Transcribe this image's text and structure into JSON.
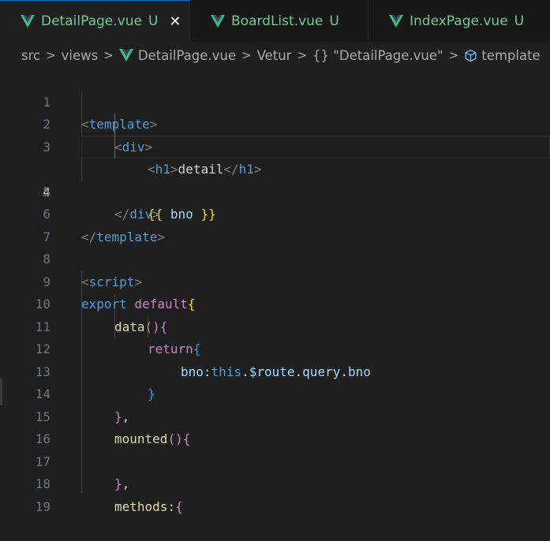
{
  "tabs": [
    {
      "label": "DetailPage.vue",
      "badge": "U",
      "close": "✕"
    },
    {
      "label": "BoardList.vue",
      "badge": "U"
    },
    {
      "label": "IndexPage.vue",
      "badge": "U"
    }
  ],
  "breadcrumb": {
    "items": [
      "src",
      "views",
      "DetailPage.vue",
      "Vetur",
      "{} \"DetailPage.vue\"",
      "template"
    ],
    "separator": ">"
  },
  "editor": {
    "current_line": "4",
    "line_numbers": [
      "1",
      "2",
      "3",
      "4",
      "5",
      "6",
      "7",
      "8",
      "9",
      "10",
      "11",
      "12",
      "13",
      "14",
      "15",
      "16",
      "17",
      "18",
      "19"
    ],
    "code": {
      "l1": {
        "a": "<",
        "b": "template",
        "c": ">"
      },
      "l2": {
        "a": "<",
        "b": "div",
        "c": ">"
      },
      "l3": {
        "a": "<",
        "b": "h1",
        "c": ">",
        "d": "detail",
        "e": "</",
        "f": "h1",
        "g": ">"
      },
      "l4": {
        "a": "{{",
        "b": " bno ",
        "c": "}}"
      },
      "l5": {
        "a": "</",
        "b": "div",
        "c": ">"
      },
      "l6": {
        "a": "</",
        "b": "template",
        "c": ">"
      },
      "l8": {
        "a": "<",
        "b": "script",
        "c": ">"
      },
      "l9": {
        "a": "export",
        "b": " default",
        "c": "{"
      },
      "l10": {
        "a": "data",
        "b": "()",
        "c": "{"
      },
      "l11": {
        "a": "return",
        "b": "{"
      },
      "l12": {
        "a": "bno",
        "b": ":",
        "c": "this",
        "d": ".",
        "e": "$route",
        "f": ".",
        "g": "query",
        "h": ".",
        "i": "bno"
      },
      "l13": {
        "a": "}"
      },
      "l14": {
        "a": "}",
        "b": ","
      },
      "l15": {
        "a": "mounted",
        "b": "()",
        "c": "{"
      },
      "l17": {
        "a": "}",
        "b": ","
      },
      "l18": {
        "a": "methods",
        "b": ":",
        "c": "{"
      }
    }
  },
  "colors": {
    "vue_green": "#41b883",
    "git_untracked": "#73c991",
    "background": "#1f1f1f",
    "tag_bracket": "#808080",
    "tag_name": "#569cd6",
    "keyword_control": "#c586c0",
    "function": "#dcdcaa",
    "bracket_gold": "#ffd700",
    "bracket_blue": "#179fff",
    "variable": "#9cdcfe"
  },
  "icons": [
    "vue-logo-icon",
    "close-icon",
    "chevron-right-icon",
    "braces-icon",
    "cube-icon"
  ]
}
